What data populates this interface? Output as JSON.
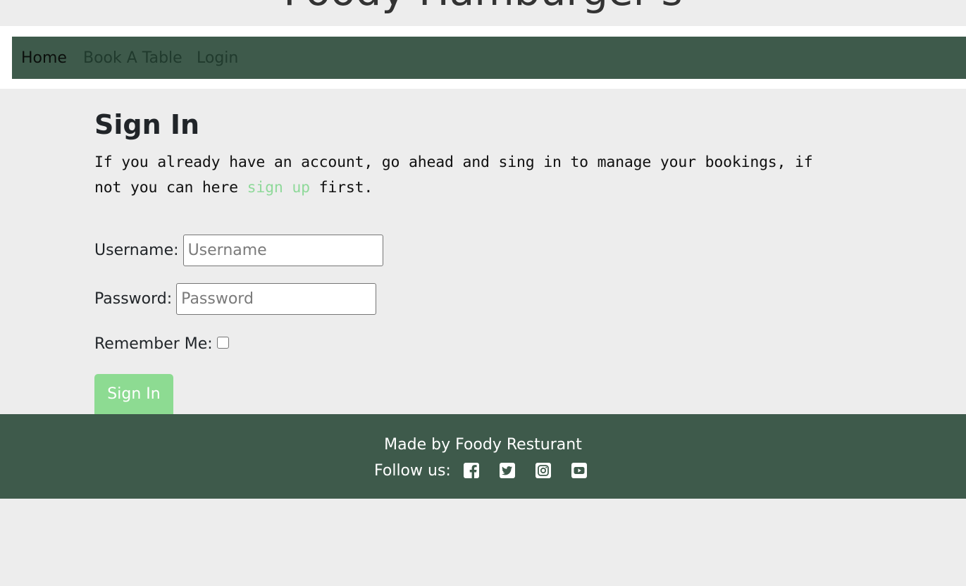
{
  "header": {
    "brand_title": "Foody  Hamburger's"
  },
  "nav": {
    "items": [
      {
        "label": "Home"
      },
      {
        "label": "Book A Table"
      },
      {
        "label": "Login"
      }
    ]
  },
  "signin": {
    "title": "Sign In",
    "intro_before": "If you already have an account, go ahead and sing in to manage your bookings, if not you can here ",
    "signup_link": "sign up",
    "intro_after": " first.",
    "username_label": "Username:",
    "username_placeholder": "Username",
    "username_value": "",
    "password_label": "Password:",
    "password_placeholder": "Password",
    "password_value": "",
    "remember_label": "Remember Me:",
    "remember_checked": false,
    "submit_label": "Sign In"
  },
  "footer": {
    "made_by": "Made by Foody Resturant",
    "follow_label": "Follow us:",
    "social": [
      "facebook-icon",
      "twitter-icon",
      "instagram-icon",
      "youtube-icon"
    ]
  },
  "colors": {
    "primary_green": "#3e5a4b",
    "accent_green": "#8ddb92",
    "page_background": "#ededed"
  }
}
